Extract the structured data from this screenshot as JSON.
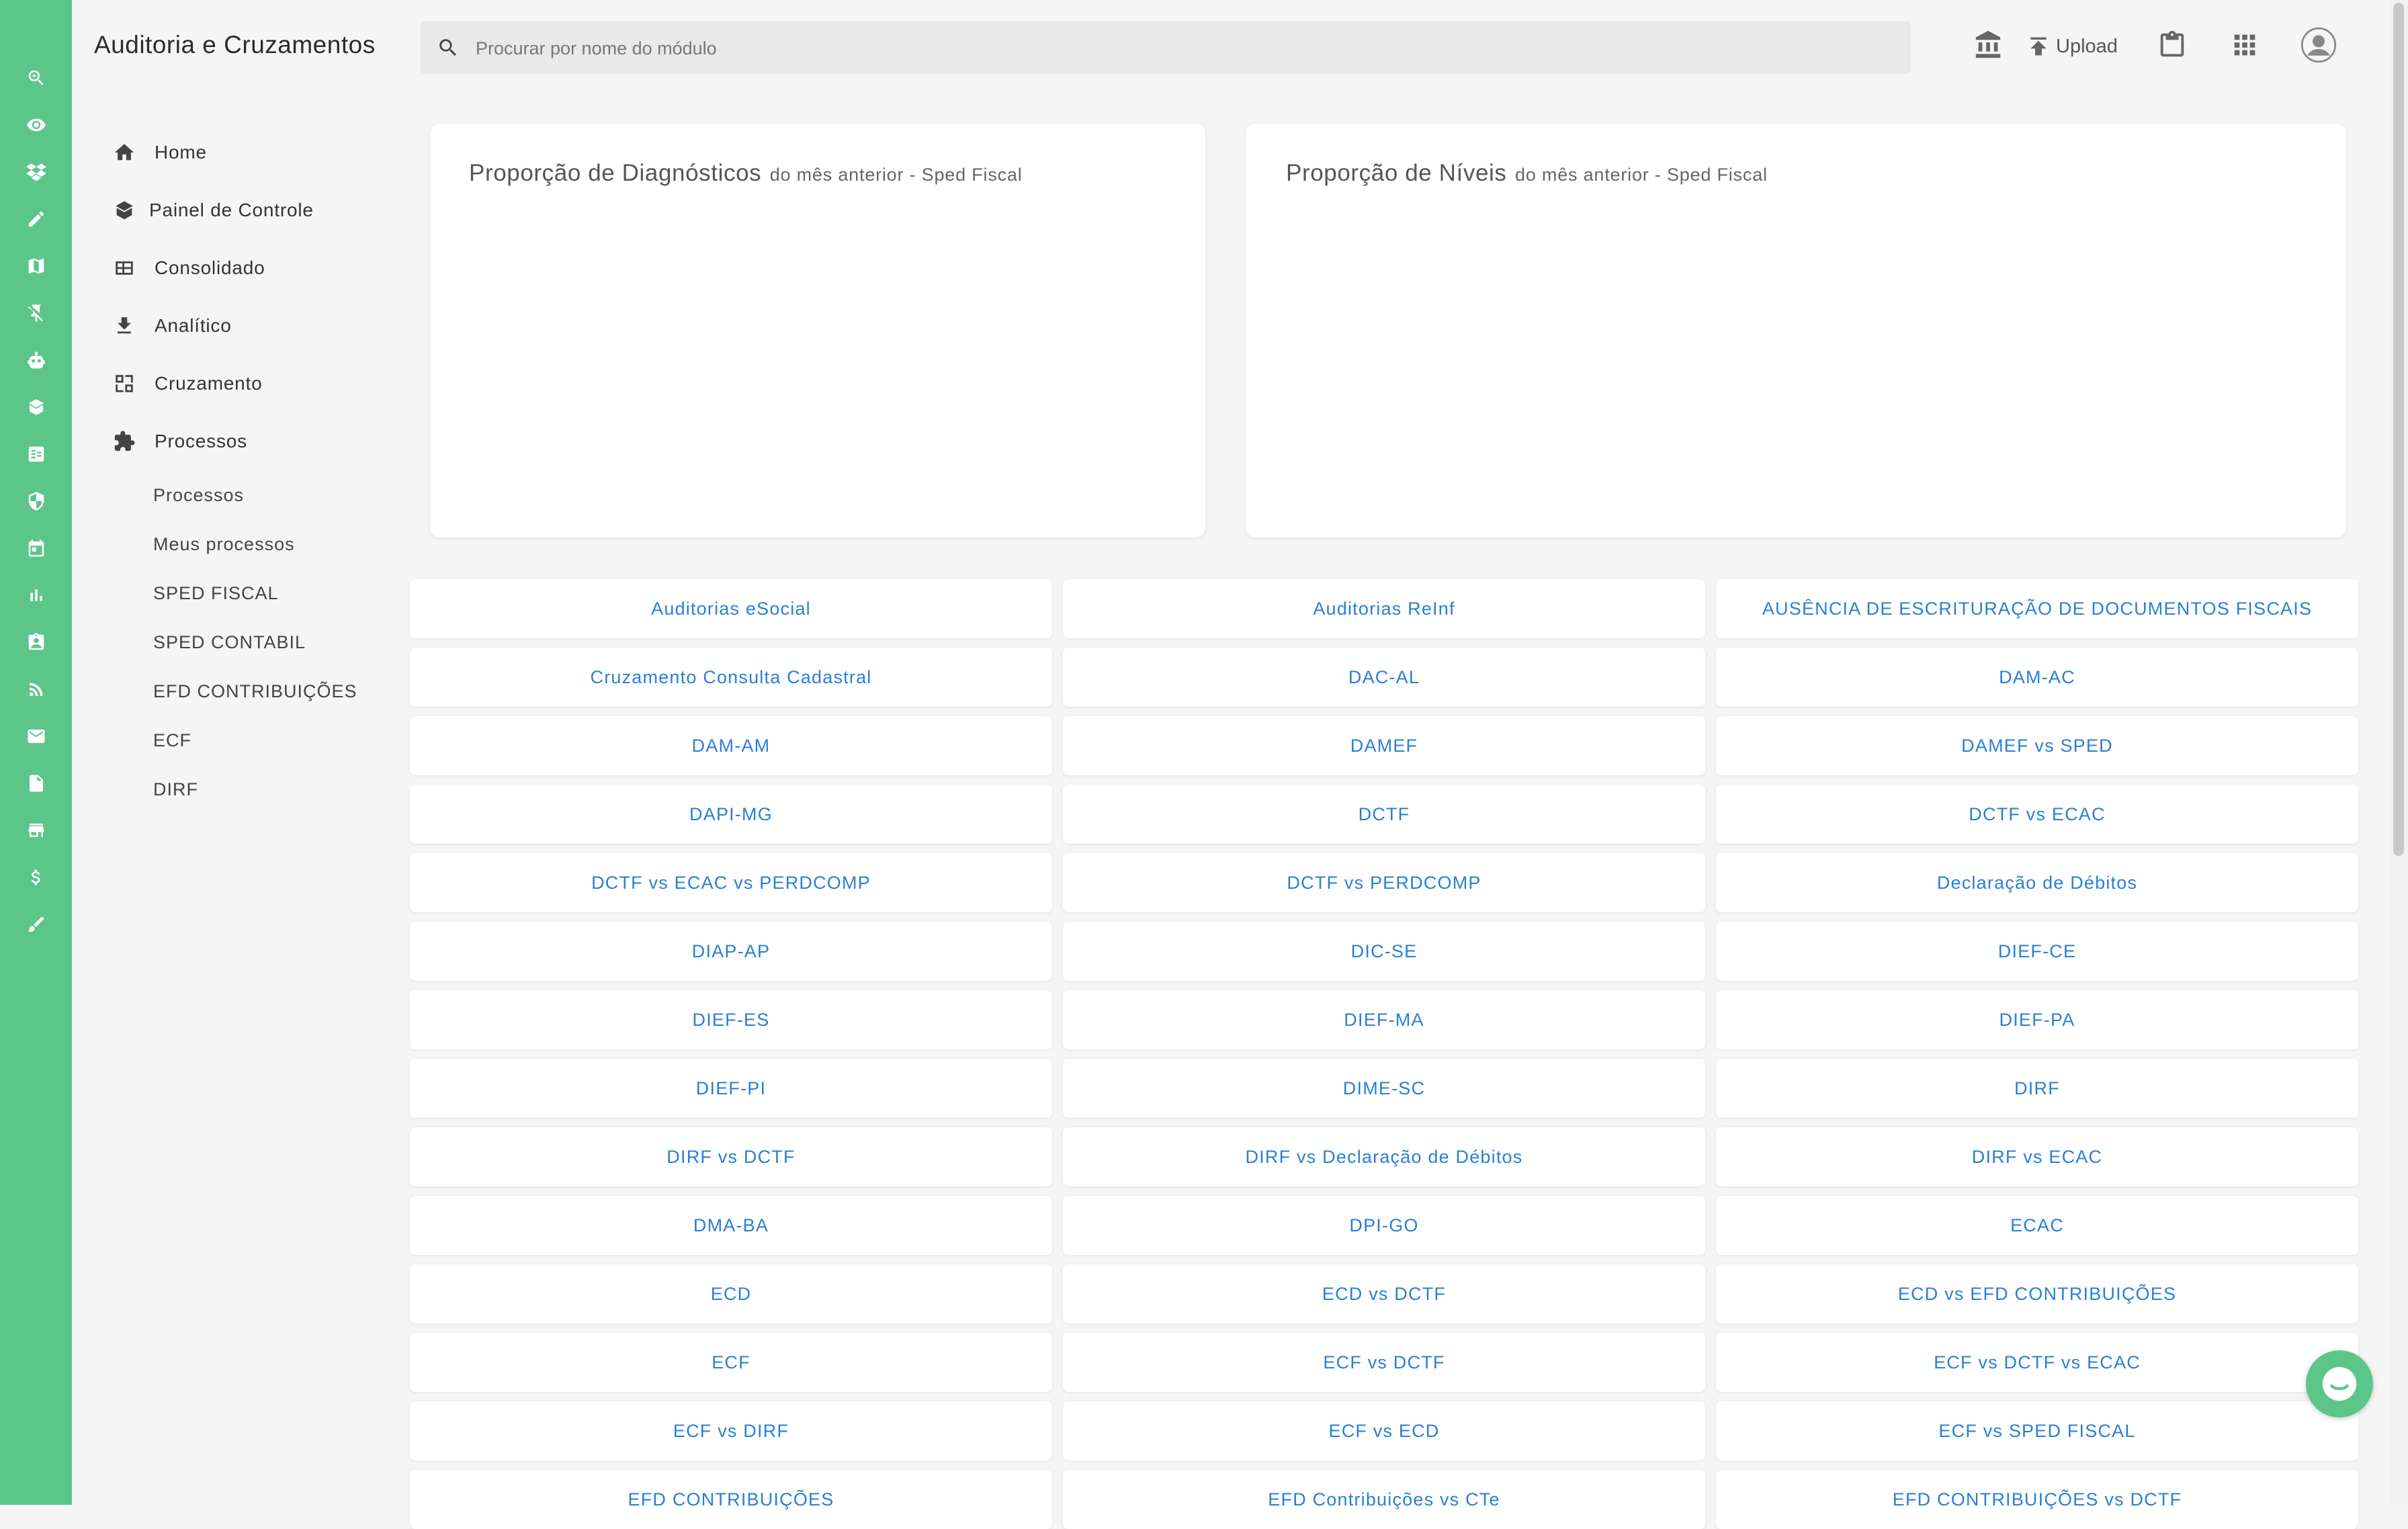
{
  "header": {
    "app_title": "Auditoria e Cruzamentos",
    "search_placeholder": "Procurar por nome do módulo",
    "upload_label": "Upload"
  },
  "rail_icons": [
    "search-icon",
    "eye-icon",
    "dropbox-icon",
    "pencil-icon",
    "map-icon",
    "pin-off-icon",
    "robot-icon",
    "book-icon",
    "table-icon",
    "shield-icon",
    "calendar-icon",
    "bar-chart-icon",
    "badge-icon",
    "rss-icon",
    "mail-icon",
    "file-icon",
    "store-icon",
    "dollar-icon",
    "brush-icon"
  ],
  "sidebar": {
    "items": [
      {
        "label": "Home",
        "icon": "home-icon"
      },
      {
        "label": "Painel de Controle",
        "icon": "book-icon"
      },
      {
        "label": "Consolidado",
        "icon": "table-icon"
      },
      {
        "label": "Analítico",
        "icon": "download-icon"
      },
      {
        "label": "Cruzamento",
        "icon": "crossing-icon"
      },
      {
        "label": "Processos",
        "icon": "puzzle-icon"
      }
    ],
    "sub_items": [
      "Processos",
      "Meus processos",
      "SPED FISCAL",
      "SPED CONTABIL",
      "EFD CONTRIBUIÇÕES",
      "ECF",
      "DIRF"
    ]
  },
  "cards": [
    {
      "title": "Proporção de Diagnósticos",
      "subtitle": "do mês anterior - Sped Fiscal"
    },
    {
      "title": "Proporção de Níveis",
      "subtitle": "do mês anterior - Sped Fiscal"
    }
  ],
  "modules": [
    "Auditorias eSocial",
    "Auditorias ReInf",
    "AUSÊNCIA DE ESCRITURAÇÃO DE DOCUMENTOS FISCAIS",
    "Cruzamento Consulta Cadastral",
    "DAC-AL",
    "DAM-AC",
    "DAM-AM",
    "DAMEF",
    "DAMEF vs SPED",
    "DAPI-MG",
    "DCTF",
    "DCTF vs ECAC",
    "DCTF vs ECAC vs PERDCOMP",
    "DCTF vs PERDCOMP",
    "Declaração de Débitos",
    "DIAP-AP",
    "DIC-SE",
    "DIEF-CE",
    "DIEF-ES",
    "DIEF-MA",
    "DIEF-PA",
    "DIEF-PI",
    "DIME-SC",
    "DIRF",
    "DIRF vs DCTF",
    "DIRF vs Declaração de Débitos",
    "DIRF vs ECAC",
    "DMA-BA",
    "DPI-GO",
    "ECAC",
    "ECD",
    "ECD vs DCTF",
    "ECD vs EFD CONTRIBUIÇÕES",
    "ECF",
    "ECF vs DCTF",
    "ECF vs DCTF vs ECAC",
    "ECF vs DIRF",
    "ECF vs ECD",
    "ECF vs SPED FISCAL",
    "EFD CONTRIBUIÇÕES",
    "EFD Contribuições vs CTe",
    "EFD CONTRIBUIÇÕES vs DCTF"
  ],
  "colors": {
    "rail": "#5cc689",
    "link": "#2a7fd4",
    "background": "#f5f5f5"
  }
}
